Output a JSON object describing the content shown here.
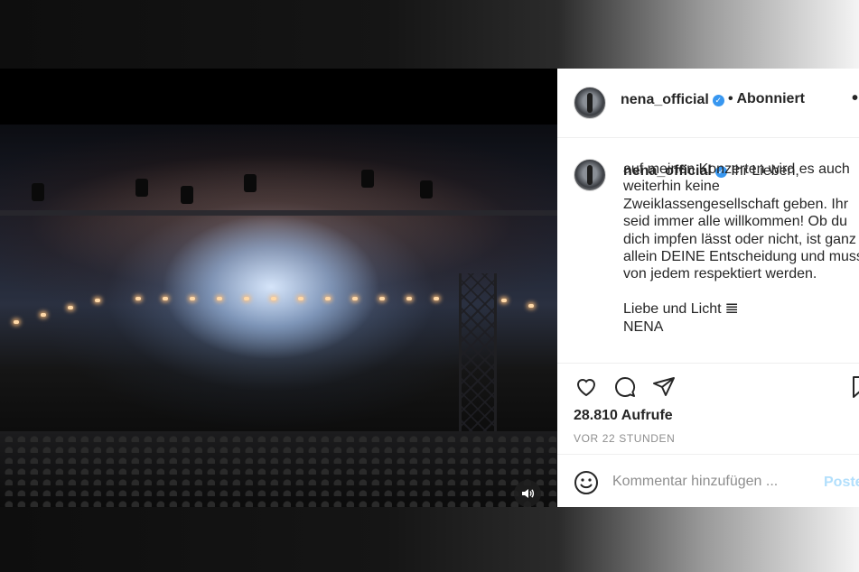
{
  "post": {
    "username": "nena_official",
    "follow_status": "Abonniert",
    "more_glyph": "•",
    "caption_username": "nena_official",
    "caption_first_line": "Ihr Lieben,",
    "caption_body": "auf meinen Konzerten wird es auch\nweiterhin keine\nZweiklassengesellschaft geben. Ihr\nseid immer alle willkommen! Ob du\ndich impfen lässt oder nicht, ist ganz\nallein DEINE Entscheidung und muss\nvon jedem respektiert werden.\n\nLiebe und Licht 𝌆\nNENA",
    "views": "28.810 Aufrufe",
    "timestamp": "VOR 22 STUNDEN"
  },
  "comment": {
    "placeholder": "Kommentar hinzufügen ...",
    "post_label": "Posten"
  },
  "icons": {
    "like": "heart-icon",
    "comment": "comment-bubble-icon",
    "share": "paper-plane-icon",
    "save": "bookmark-icon",
    "emoji": "smiley-icon",
    "sound": "speaker-icon",
    "verified": "verified-badge-icon"
  },
  "colors": {
    "verified": "#3897f0",
    "post_button": "#b2dffc",
    "secondary_text": "#8e8e8e"
  }
}
